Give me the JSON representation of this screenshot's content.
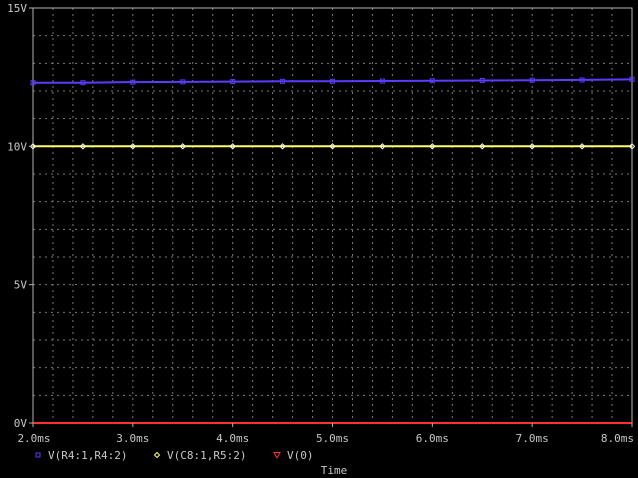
{
  "chart_data": {
    "type": "line",
    "xlabel": "Time",
    "ylabel": "",
    "xlim": [
      2.0,
      8.0
    ],
    "ylim": [
      0,
      15
    ],
    "x_unit": "ms",
    "grid": true,
    "legend_position": "bottom-left",
    "x_ticks": [
      2.0,
      3.0,
      4.0,
      5.0,
      6.0,
      7.0,
      8.0
    ],
    "x_tick_labels": [
      "2.0ms",
      "3.0ms",
      "4.0ms",
      "5.0ms",
      "6.0ms",
      "7.0ms",
      "8.0ms"
    ],
    "y_ticks": [
      0,
      5,
      10,
      15
    ],
    "y_tick_labels": [
      "0V",
      "5V",
      "10V",
      "15V"
    ],
    "series": [
      {
        "name": "V(R4:1,R4:2)",
        "color": "#5a3cff",
        "marker": "square",
        "x": [
          2.0,
          2.5,
          3.0,
          3.5,
          4.0,
          4.5,
          5.0,
          5.5,
          6.0,
          6.5,
          7.0,
          7.5,
          8.0
        ],
        "values": [
          12.3,
          12.3,
          12.32,
          12.33,
          12.34,
          12.35,
          12.35,
          12.36,
          12.37,
          12.38,
          12.39,
          12.4,
          12.42
        ]
      },
      {
        "name": "V(C8:1,R5:2)",
        "color": "#ffff66",
        "marker": "diamond",
        "x": [
          2.0,
          2.5,
          3.0,
          3.5,
          4.0,
          4.5,
          5.0,
          5.5,
          6.0,
          6.5,
          7.0,
          7.5,
          8.0
        ],
        "values": [
          10.0,
          10.0,
          10.0,
          10.0,
          10.0,
          10.0,
          10.0,
          10.0,
          10.0,
          10.0,
          10.0,
          10.0,
          10.0
        ]
      },
      {
        "name": "V(0)",
        "color": "#ff3030",
        "marker": "triangle",
        "x": [
          2.0,
          8.0
        ],
        "values": [
          0,
          0
        ]
      }
    ]
  }
}
